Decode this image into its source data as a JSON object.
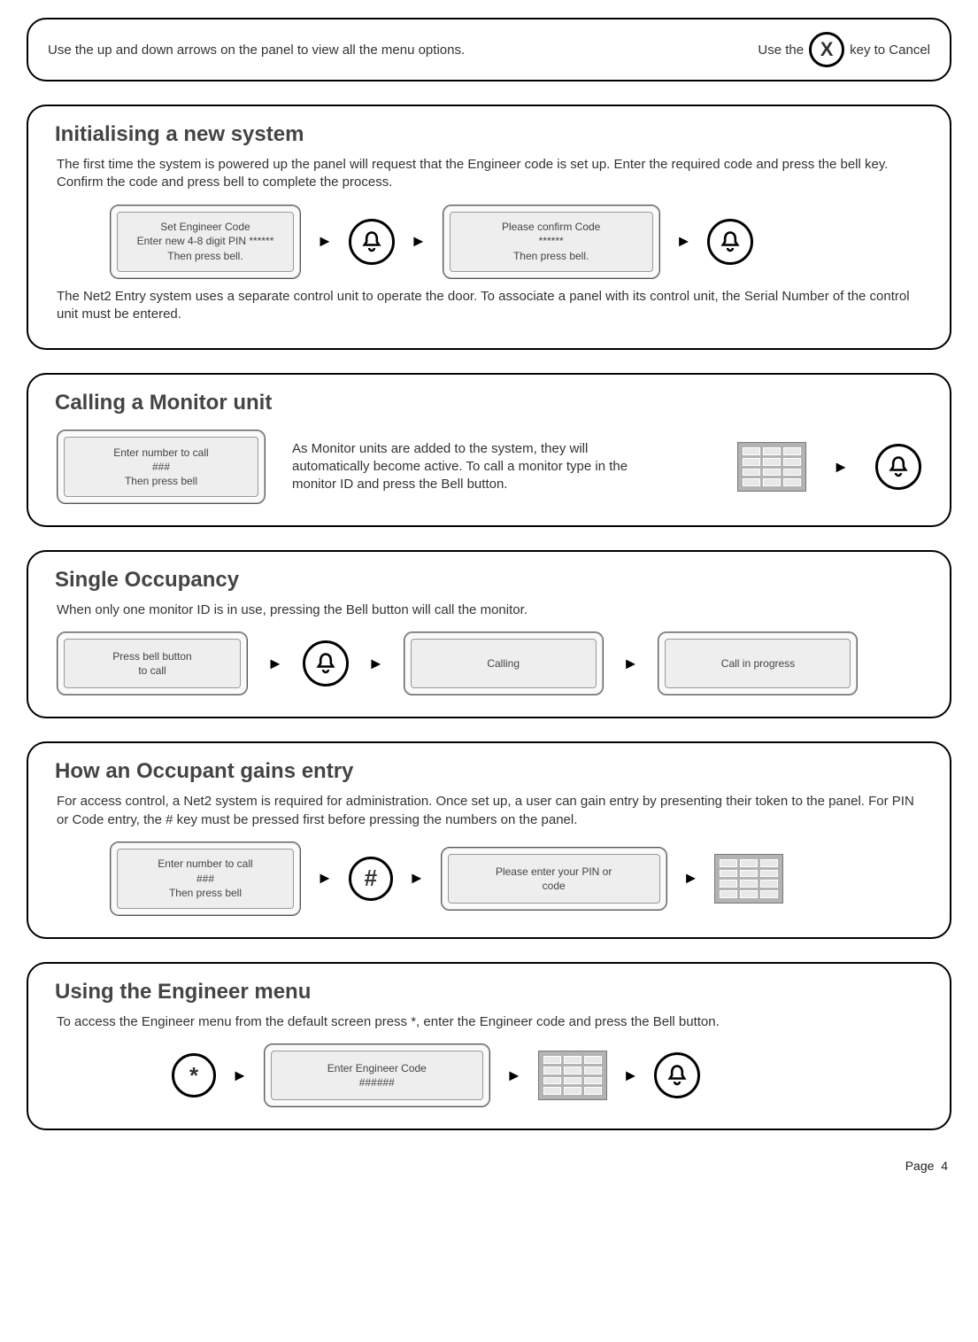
{
  "top": {
    "left": "Use the up and down arrows on the panel to view all the menu options.",
    "right_prefix": "Use the",
    "right_key": "X",
    "right_suffix": "key to Cancel"
  },
  "sections": {
    "init": {
      "heading": "Initialising a new system",
      "p1": "The first time the system is powered up the panel will request that the Engineer code is set up. Enter the required code and press the bell key. Confirm the code and press bell to complete the process.",
      "lcd1_l1": "Set Engineer Code",
      "lcd1_l2": "Enter new 4-8 digit PIN ******",
      "lcd1_l3": "Then press bell.",
      "lcd2_l1": "Please confirm Code",
      "lcd2_l2": "******",
      "lcd2_l3": "Then press bell.",
      "p2": "The Net2 Entry system uses a separate control unit to operate the door. To associate a panel with its control unit, the Serial Number of the control unit must be entered."
    },
    "call": {
      "heading": "Calling a Monitor unit",
      "lcd_l1": "Enter number to call",
      "lcd_l2": "###",
      "lcd_l3": "Then press bell",
      "text": "As Monitor units are added to the system, they will automatically become active. To call a monitor type in the monitor ID and press the Bell button."
    },
    "single": {
      "heading": "Single Occupancy",
      "p1": "When only one monitor ID is in use, pressing the Bell button will call the monitor.",
      "lcd1_l1": "Press bell button",
      "lcd1_l2": "to call",
      "lcd2": "Calling",
      "lcd3": "Call in progress"
    },
    "entry": {
      "heading": "How an Occupant gains entry",
      "p1": "For access control, a Net2 system is required for administration. Once set up, a user can gain entry by presenting their token to the panel. For PIN or Code entry, the # key must be pressed first before pressing the numbers on the panel.",
      "lcd1_l1": "Enter number to call",
      "lcd1_l2": "###",
      "lcd1_l3": "Then press bell",
      "hash": "#",
      "lcd2_l1": "Please enter your PIN or",
      "lcd2_l2": "code"
    },
    "engineer": {
      "heading": "Using the Engineer menu",
      "p1": "To access the Engineer menu from the default screen press *, enter the Engineer code and press the Bell button.",
      "star": "*",
      "lcd_l1": "Enter Engineer Code",
      "lcd_l2": "######"
    }
  },
  "footer": {
    "page_label": "Page",
    "page_number": "4"
  }
}
